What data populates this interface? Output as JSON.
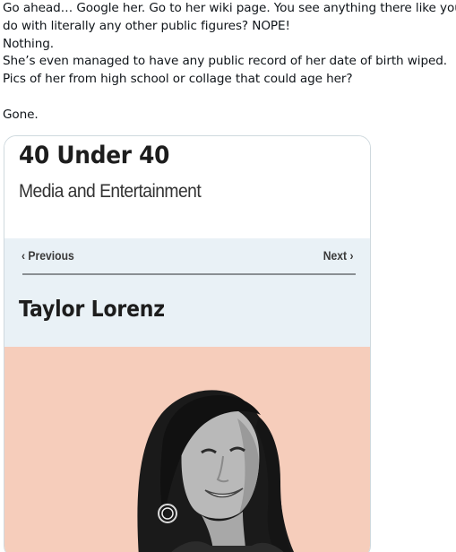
{
  "tweet": {
    "lines": [
      "Go ahead… Google her. Go to her wiki page. You see anything there like you",
      "do with literally any other public figures? NOPE!",
      "Nothing.",
      "She’s even managed to have any public record of her date of birth wiped.",
      "Pics of her from high school or collage that could age her?",
      "",
      "Gone."
    ]
  },
  "media": {
    "title": "40 Under 40",
    "subtitle": "Media and Entertainment",
    "nav": {
      "previous": "‹ Previous",
      "next": "Next ›"
    },
    "person_name": "Taylor Lorenz",
    "photo_background": "#f6cdbb",
    "nav_background": "#e9f1f6",
    "photo_icon": "portrait-photo"
  }
}
